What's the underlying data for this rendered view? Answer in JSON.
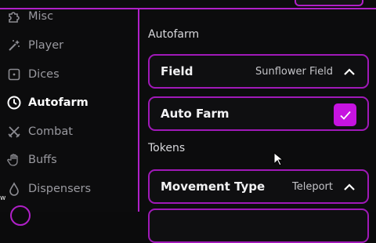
{
  "sidebar": {
    "items": [
      {
        "label": "Misc",
        "icon": "puzzle-icon",
        "active": false
      },
      {
        "label": "Player",
        "icon": "magic-wand-icon",
        "active": false
      },
      {
        "label": "Dices",
        "icon": "dice-icon",
        "active": false
      },
      {
        "label": "Autofarm",
        "icon": "clock-icon",
        "active": true
      },
      {
        "label": "Combat",
        "icon": "crossed-swords-icon",
        "active": false
      },
      {
        "label": "Buffs",
        "icon": "hand-icon",
        "active": false
      },
      {
        "label": "Dispensers",
        "icon": "droplet-icon",
        "active": false
      }
    ]
  },
  "main": {
    "autofarm_section": "Autofarm",
    "field": {
      "label": "Field",
      "value": "Sunflower Field"
    },
    "auto_farm": {
      "label": "Auto Farm",
      "checked": true
    },
    "tokens_section": "Tokens",
    "movement": {
      "label": "Movement Type",
      "value": "Teleport"
    }
  },
  "corner_text": "w",
  "colors": {
    "accent": "#b020c8",
    "checkbox": "#c613e0",
    "background": "#0c0c0d"
  }
}
